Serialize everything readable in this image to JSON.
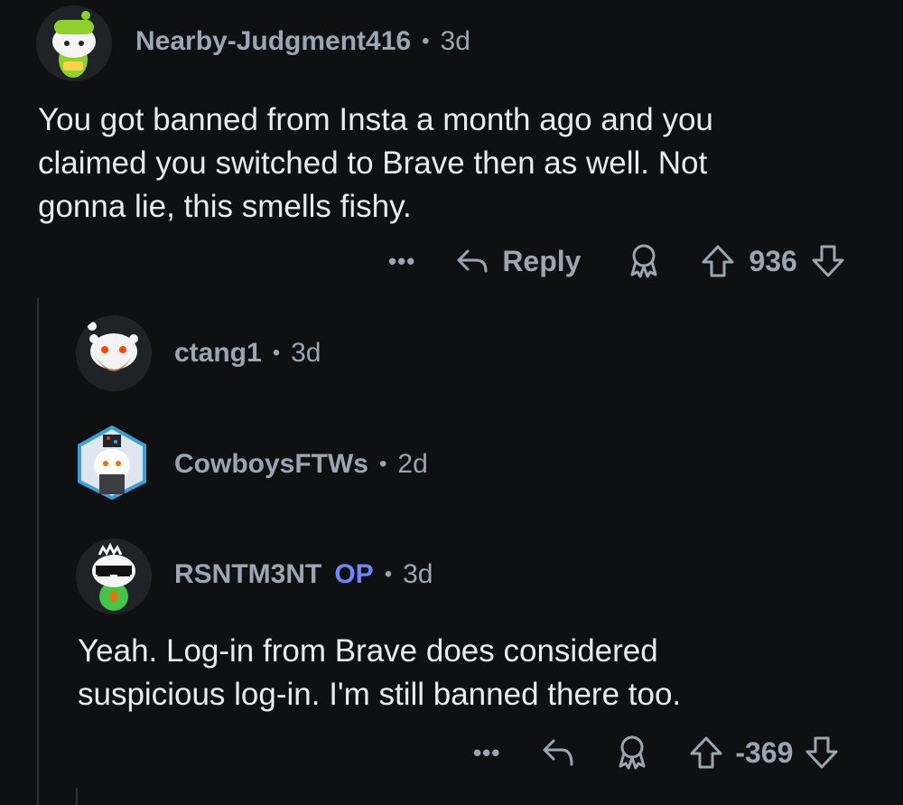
{
  "comments": [
    {
      "user": "Nearby-Judgment416",
      "age": "3d",
      "text_lines": [
        "You got banned from Insta a month ago and you",
        "claimed you switched to Brave then as well. Not",
        "gonna lie, this smells fishy."
      ],
      "actions": {
        "more": "•••",
        "reply": "Reply",
        "score": "936"
      }
    },
    {
      "user": "ctang1",
      "age": "3d"
    },
    {
      "user": "CowboysFTWs",
      "age": "2d"
    },
    {
      "user": "RSNTM3NT",
      "badge": "OP",
      "age": "3d",
      "text_lines": [
        "Yeah. Log-in from Brave does considered",
        "suspicious log-in. I'm still banned there too."
      ],
      "actions": {
        "more": "•••",
        "score": "-369"
      }
    }
  ],
  "icons": {
    "reply": "reply-arrow-icon",
    "award": "award-icon",
    "upvote": "upvote-arrow-icon",
    "downvote": "downvote-arrow-icon"
  },
  "colors": {
    "background": "#0e1012",
    "meta_text": "#9aa7b3",
    "body_text": "#e9ebed",
    "op_badge": "#6f86ff"
  }
}
